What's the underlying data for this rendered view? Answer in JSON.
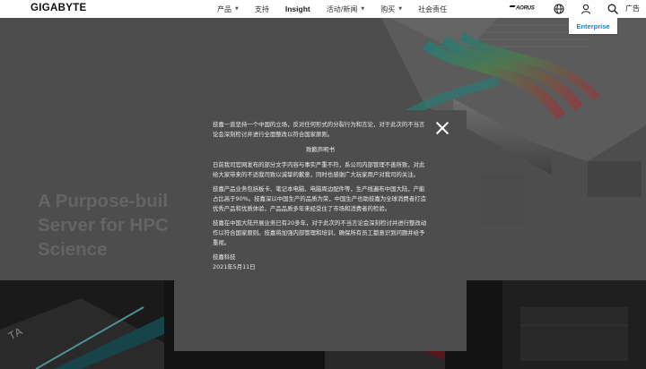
{
  "nav": {
    "logo": "GIGABYTE",
    "menu": [
      {
        "label": "产品",
        "has_dropdown": true
      },
      {
        "label": "支持",
        "has_dropdown": false
      },
      {
        "label": "Insight",
        "has_dropdown": false
      },
      {
        "label": "活动/新闻",
        "has_dropdown": true
      },
      {
        "label": "购买",
        "has_dropdown": true
      },
      {
        "label": "社会责任",
        "has_dropdown": false
      }
    ],
    "aorus": "AORUS",
    "icons": [
      "globe-icon",
      "user-icon",
      "search-icon"
    ],
    "ad_label": "广告",
    "enterprise_label": "Enterprise"
  },
  "hero": {
    "title": "A Purpose-buil\nServer for HPC\nScience"
  },
  "bottom_tile_text": "TA",
  "modal": {
    "paragraphs": [
      "技嘉一直坚持一个中国的立场，反对任何形式的分裂行为和言论，对于此次的不当言论会深刻检讨并进行全面整改以符合国家原则。"
    ],
    "heading": "致歉声明书",
    "body": [
      "日前我司官网发布的部分文字内容与事实严重不符，系公司内部管理不善所致，对此给大家带来的不适我司致以诚挚的歉意，同时也感谢广大玩家用户对我司的关注。",
      "技嘉产品业务包括板卡、笔记本电脑、电脑周边配件等，生产线遍布中国大陆，产能占比高于90%。技嘉深以中国生产的品质为荣，中国生产也助技嘉为全球消费者打造优秀产品和优质体验，产品品质多年来经受住了市场和消费者的检验。",
      "技嘉在中国大陆开展业务已有20多年，对于此次的不当言论会深刻检讨并进行整改动作以符合国家原则。技嘉将加强内部管理和培训，确保所有员工都意识到问题并给予重视。"
    ],
    "signature": "技嘉科技",
    "date": "2021年5月11日"
  },
  "colors": {
    "accent": "#1e82c8",
    "modal_bg": "#4d4d4d",
    "nav_bg": "#ffffff"
  }
}
